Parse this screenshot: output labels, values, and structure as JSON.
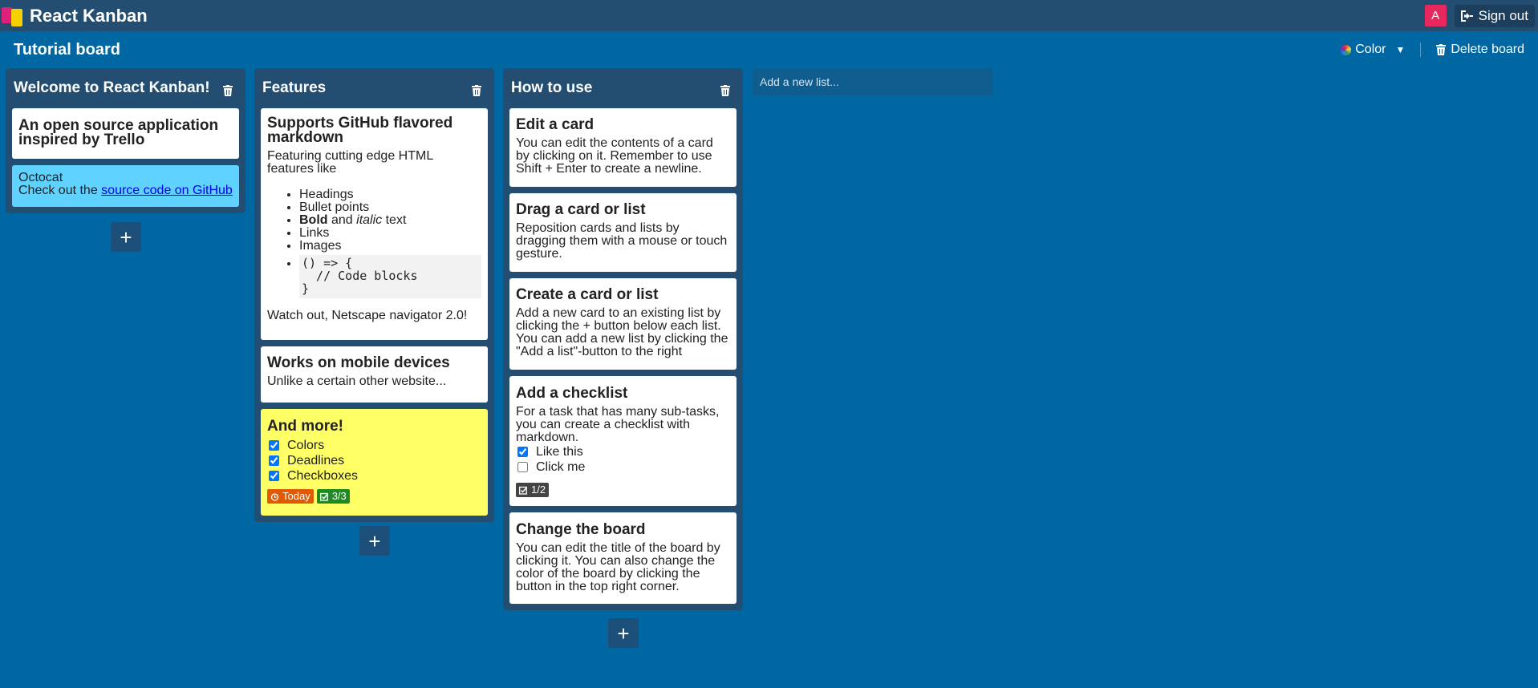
{
  "header": {
    "app_title": "React Kanban",
    "avatar_initial": "A",
    "signout_label": "Sign out",
    "avatar_color": "#e6285e",
    "logo_colors": [
      "#e0207a",
      "#f5d000"
    ]
  },
  "board": {
    "title": "Tutorial board",
    "color_label": "Color",
    "delete_label": "Delete board",
    "background": "#0067a3"
  },
  "lists": [
    {
      "title": "Welcome to React Kanban!",
      "cards": [
        {
          "title": "An open source application inspired by Trello"
        },
        {
          "image_alt": "Octocat",
          "text_prefix": "Check out the ",
          "link_text": "source code on GitHub",
          "color": "#5fd2ff"
        }
      ]
    },
    {
      "title": "Features",
      "cards": [
        {
          "title": "Supports GitHub flavored markdown",
          "intro": "Featuring cutting edge HTML features like",
          "items": [
            "Headings",
            "Bullet points",
            "Links",
            "Images"
          ],
          "bold_word": "Bold",
          "and_word": " and ",
          "italic_word": "italic",
          "text_word": " text",
          "code": "() => {\n  // Code blocks\n}",
          "footer": "Watch out, Netscape navigator 2.0!"
        },
        {
          "title": "Works on mobile devices",
          "text": "Unlike a certain other website..."
        },
        {
          "title": "And more!",
          "color": "#ffff66",
          "checklist": [
            {
              "label": "Colors",
              "checked": true
            },
            {
              "label": "Deadlines",
              "checked": true
            },
            {
              "label": "Checkboxes",
              "checked": true
            }
          ],
          "due_label": "Today",
          "due_color": "#e15a03",
          "progress_label": "3/3",
          "progress_color": "#1e8a24"
        }
      ]
    },
    {
      "title": "How to use",
      "cards": [
        {
          "title": "Edit a card",
          "text": "You can edit the contents of a card by clicking on it. Remember to use Shift + Enter to create a newline."
        },
        {
          "title": "Drag a card or list",
          "text": "Reposition cards and lists by dragging them with a mouse or touch gesture."
        },
        {
          "title": "Create a card or list",
          "text": "Add a new card to an existing list by clicking the + button below each list. You can add a new list by clicking the \"Add a list\"-button to the right"
        },
        {
          "title": "Add a checklist",
          "text": "For a task that has many sub-tasks, you can create a checklist with markdown.",
          "checklist": [
            {
              "label": "Like this",
              "checked": true
            },
            {
              "label": "Click me",
              "checked": false
            }
          ],
          "progress_label": "1/2",
          "progress_color": "#444444"
        },
        {
          "title": "Change the board",
          "text": "You can edit the title of the board by clicking it. You can also change the color of the board by clicking the button in the top right corner."
        }
      ]
    }
  ],
  "add_card_label": "+",
  "new_list_placeholder": "Add a new list..."
}
